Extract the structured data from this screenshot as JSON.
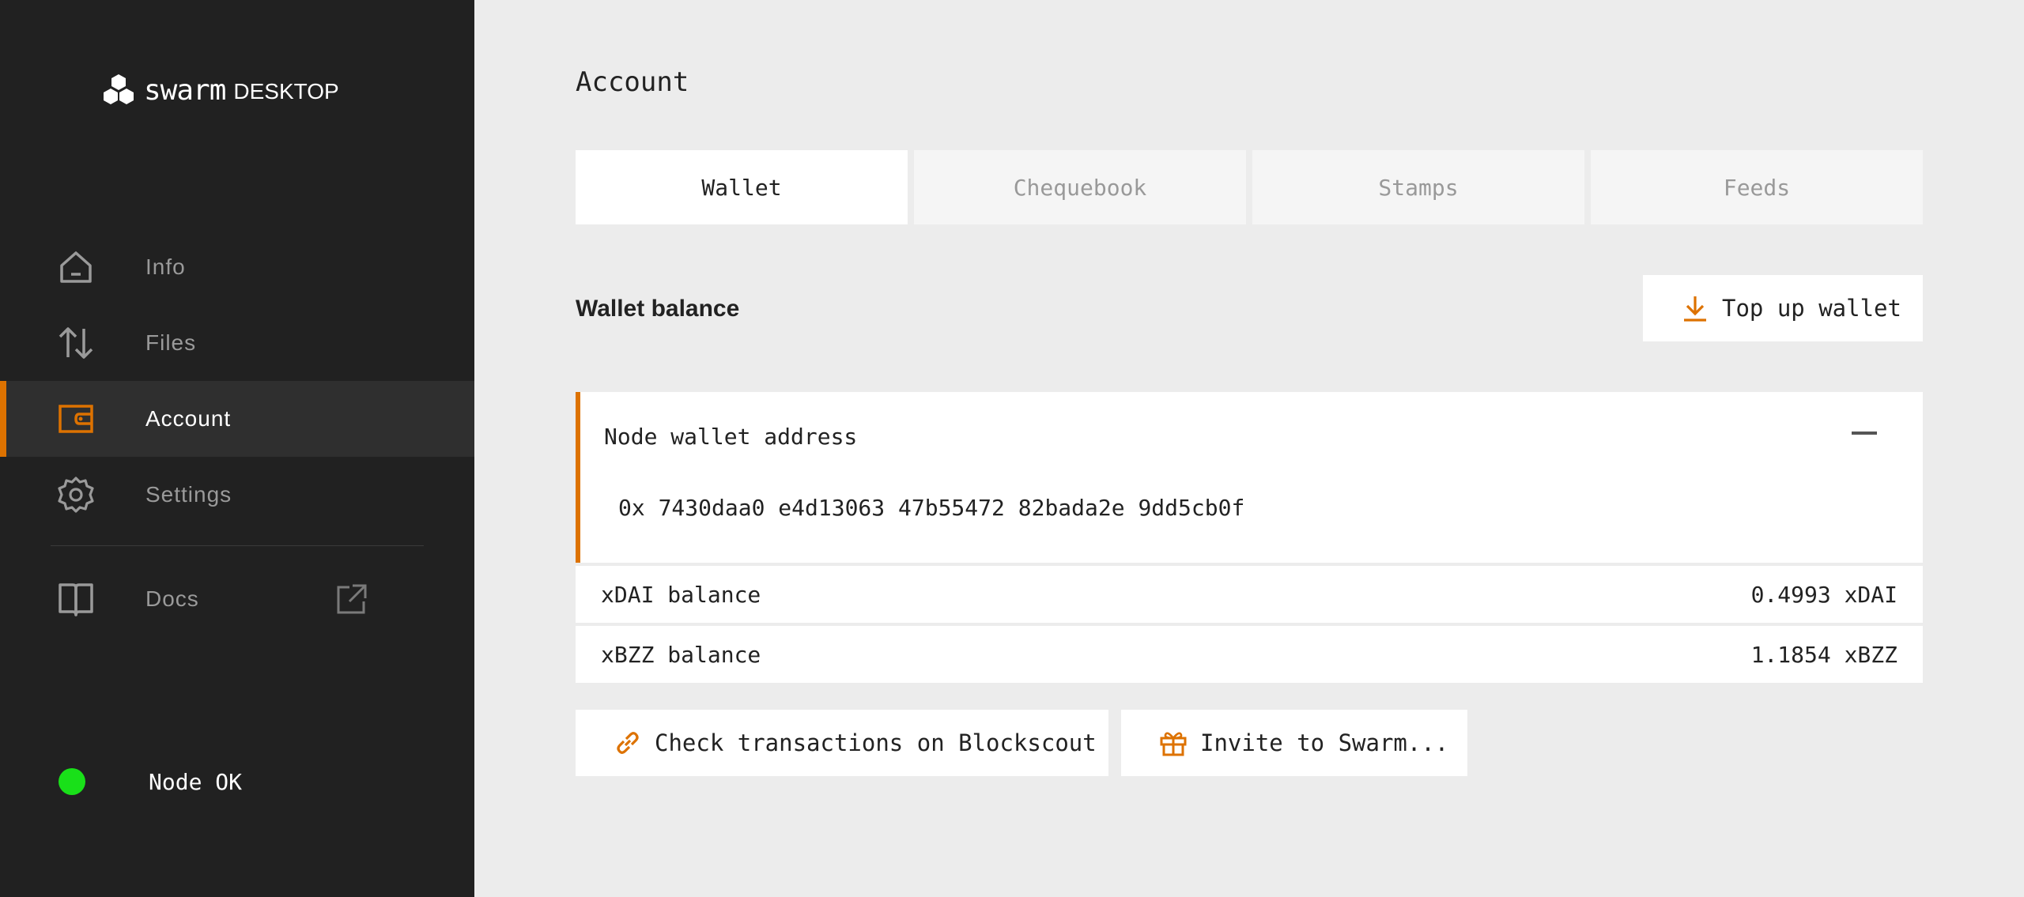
{
  "app": {
    "logo_word": "swarm",
    "logo_sub": "DESKTOP"
  },
  "sidebar": {
    "items": [
      {
        "label": "Info",
        "icon": "home-icon",
        "active": false
      },
      {
        "label": "Files",
        "icon": "transfer-arrows-icon",
        "active": false
      },
      {
        "label": "Account",
        "icon": "wallet-icon",
        "active": true
      },
      {
        "label": "Settings",
        "icon": "gear-icon",
        "active": false
      },
      {
        "label": "Docs",
        "icon": "book-icon",
        "active": false,
        "external": true
      }
    ],
    "status": {
      "label": "Node OK",
      "color": "#19e019"
    }
  },
  "main": {
    "title": "Account",
    "tabs": [
      {
        "label": "Wallet",
        "selected": true
      },
      {
        "label": "Chequebook",
        "selected": false
      },
      {
        "label": "Stamps",
        "selected": false
      },
      {
        "label": "Feeds",
        "selected": false
      }
    ],
    "wallet_section_title": "Wallet balance",
    "top_up_label": "Top up wallet",
    "address_card": {
      "label": "Node wallet address",
      "value": "0x 7430daa0 e4d13063 47b55472 82bada2e 9dd5cb0f"
    },
    "balances": [
      {
        "label": "xDAI balance",
        "value": "0.4993 xDAI"
      },
      {
        "label": "xBZZ balance",
        "value": "1.1854 xBZZ"
      }
    ],
    "actions": {
      "blockscout_label": "Check transactions on Blockscout",
      "invite_label": "Invite to Swarm..."
    }
  },
  "colors": {
    "accent": "#dd7200",
    "sidebar_bg": "#212121",
    "main_bg": "#ececec"
  }
}
